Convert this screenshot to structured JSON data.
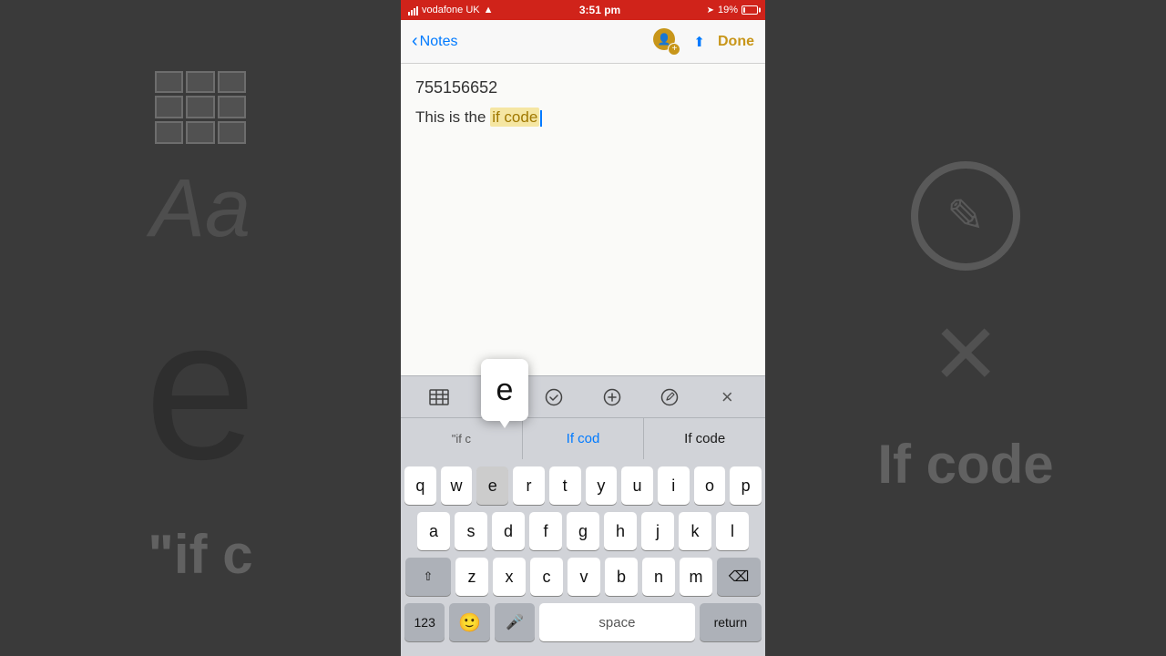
{
  "statusBar": {
    "carrier": "vodafone UK",
    "time": "3:51 pm",
    "battery": "19%",
    "wifiIcon": "wifi",
    "locationIcon": "location-arrow"
  },
  "navBar": {
    "backLabel": "Notes",
    "doneLabel": "Done",
    "shareIcon": "share",
    "collabIcon": "person-add"
  },
  "noteContent": {
    "number": "755156652",
    "textBeforeHighlight": "This is the ",
    "highlightedText": "if code",
    "cursor": "|"
  },
  "formatToolbar": {
    "tableIcon": "⊞",
    "fontIcon": "Aa",
    "checkIcon": "✓",
    "addIcon": "+",
    "penIcon": "✎",
    "closeIcon": "×"
  },
  "autocomplete": {
    "items": [
      {
        "text": "\"if c",
        "style": "quoted"
      },
      {
        "text": "If cod",
        "style": "blue"
      },
      {
        "text": "If code",
        "style": "dark"
      }
    ]
  },
  "keyPopup": {
    "letter": "e"
  },
  "keyboard": {
    "row1": [
      "q",
      "w",
      "e",
      "r",
      "t",
      "y",
      "u",
      "i",
      "o",
      "p"
    ],
    "row2": [
      "a",
      "s",
      "d",
      "f",
      "g",
      "h",
      "j",
      "k",
      "l"
    ],
    "row3": [
      "z",
      "x",
      "c",
      "v",
      "b",
      "n",
      "m"
    ],
    "spaceLabel": "space",
    "returnLabel": "return",
    "numLabel": "123",
    "deleteIcon": "⌫",
    "shiftIcon": "⇧",
    "emojiIcon": "🙂",
    "micIcon": "🎤"
  },
  "bgLeft": {
    "tableDesc": "table-icon",
    "eLetter": "e",
    "quotedText": "\"if c"
  },
  "bgRight": {
    "circleIcon": "circle-pen-icon",
    "xIcon": "×",
    "ifCodeText": "If code"
  }
}
